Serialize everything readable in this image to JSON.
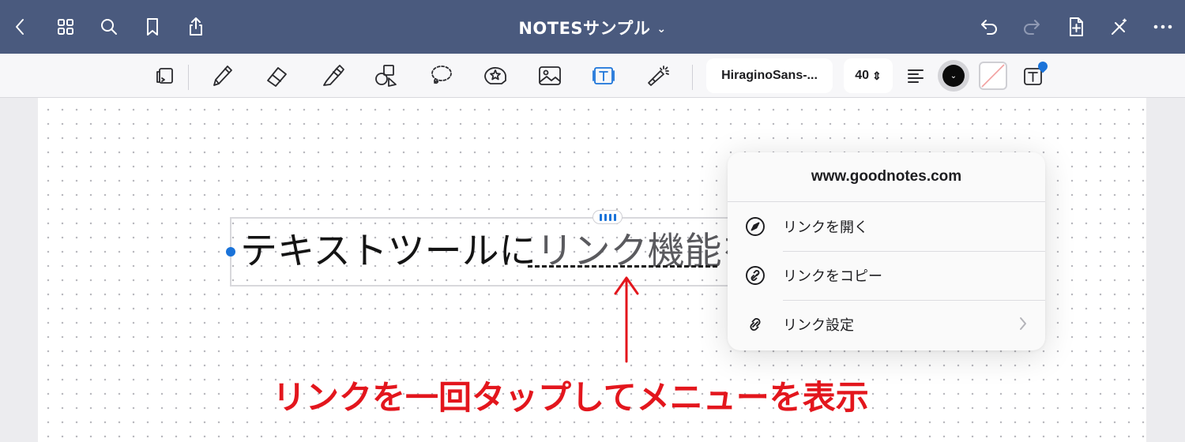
{
  "navbar": {
    "title": "NOTESサンプル",
    "title_chevron": "⌄",
    "icons": [
      "back-icon",
      "grid-icon",
      "search-icon",
      "bookmark-icon",
      "share-icon",
      "undo-icon",
      "redo-icon",
      "add-page-icon",
      "close-pen-icon",
      "more-icon"
    ]
  },
  "toolbar": {
    "tools": [
      "lasso-layer-icon",
      "pen-icon",
      "eraser-icon",
      "highlighter-icon",
      "shapes-icon",
      "lasso-icon",
      "sticker-icon",
      "image-icon",
      "text-tool-icon",
      "laser-pointer-icon"
    ],
    "active_tool": "text-tool-icon",
    "font_name": "HiraginoSans-...",
    "font_size": "40",
    "font_size_arrows": "⇕",
    "text_color": "#000000",
    "accent": "#1a73d9"
  },
  "textbox": {
    "text_plain": "テキストツールに",
    "text_link": "リンク機能を"
  },
  "popup": {
    "url": "www.goodnotes.com",
    "items": [
      {
        "label": "リンクを開く",
        "icon": "compass-icon"
      },
      {
        "label": "リンクをコピー",
        "icon": "copy-link-icon"
      },
      {
        "label": "リンク設定",
        "icon": "link-icon"
      }
    ]
  },
  "annotation": {
    "text": "リンクを一回タップしてメニューを表示",
    "color": "#e3161d"
  }
}
